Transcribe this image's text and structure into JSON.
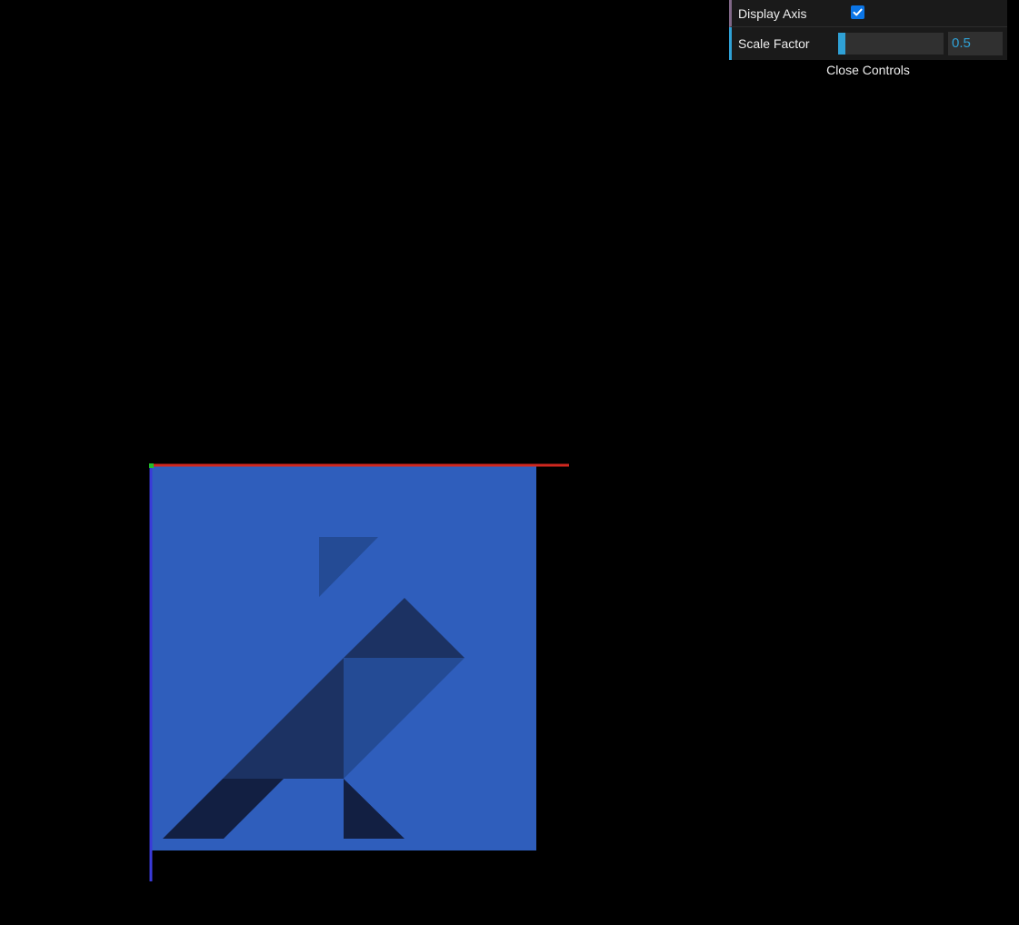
{
  "gui": {
    "display_axis": {
      "label": "Display Axis",
      "checked": true
    },
    "scale_factor": {
      "label": "Scale Factor",
      "value": "0.5",
      "fill_fraction": 0.07
    },
    "close_label": "Close Controls"
  },
  "scene": {
    "background_color": "#000000",
    "plane_color": "#2f5ebc",
    "axis_colors": {
      "x": "#d0281f",
      "y": "#22c02a",
      "z": "#3a3ad8"
    },
    "tangram_colors": {
      "dark_navy": "#121f42",
      "navy": "#1c3263",
      "mid_blue": "#244b95"
    }
  }
}
